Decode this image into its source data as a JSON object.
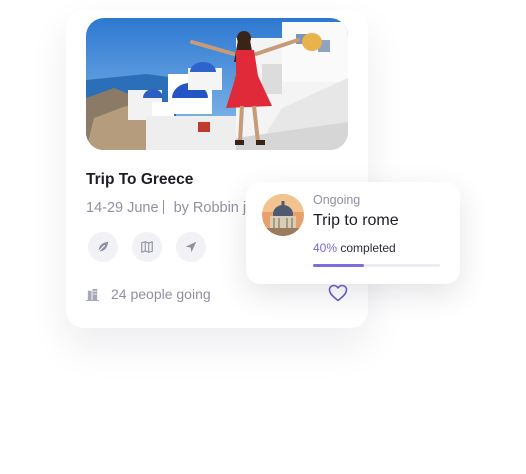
{
  "trip_card": {
    "title": "Trip To Greece",
    "dates": "14-29 June",
    "organizer": "by Robbin jo",
    "action_icons": [
      "leaf-icon",
      "map-icon",
      "navigation-icon"
    ],
    "attendees": "24 people going",
    "favorite_icon": "heart-icon"
  },
  "ongoing_card": {
    "status": "Ongoing",
    "title": "Trip to rome",
    "progress_percent_label": "40%",
    "progress_suffix": " completed",
    "progress_fraction": 0.4
  },
  "colors": {
    "accent": "#7b6ed9",
    "muted_text": "#8f90a3",
    "dress_red": "#e02a3a"
  }
}
